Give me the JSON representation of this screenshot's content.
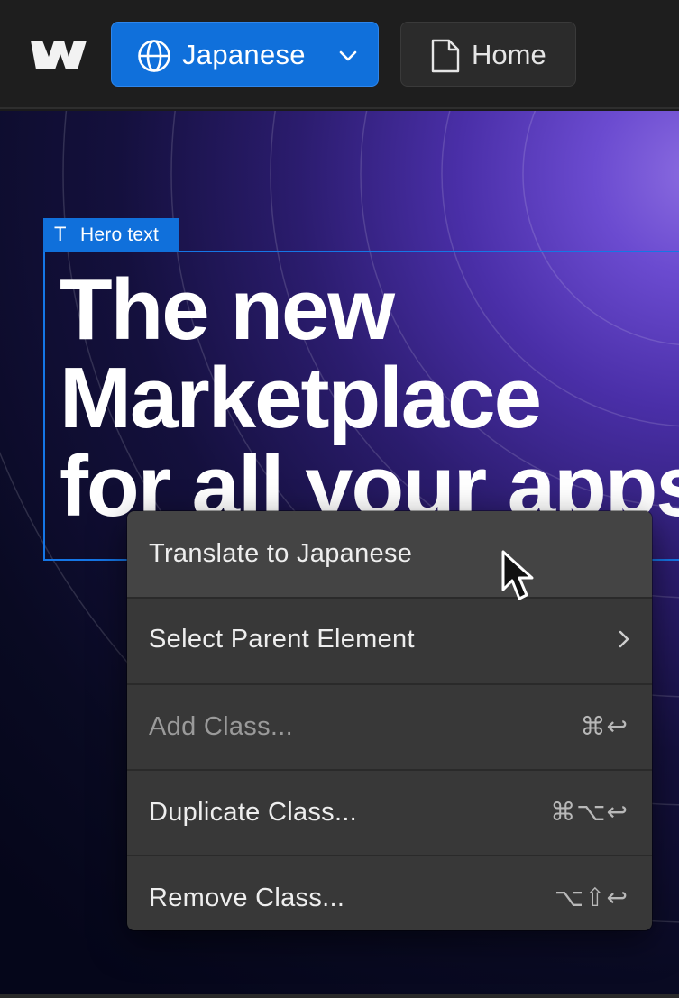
{
  "topbar": {
    "logo_icon": "webflow-logo",
    "locale": {
      "label": "Japanese",
      "icon": "globe-icon",
      "dropdown_icon": "chevron-down-icon"
    },
    "page": {
      "label": "Home",
      "icon": "page-icon"
    }
  },
  "canvas": {
    "selection_tag": {
      "icon": "T",
      "label": "Hero text"
    },
    "hero_lines": [
      "The new",
      "Marketplace",
      "for all your apps"
    ]
  },
  "context_menu": {
    "items": [
      {
        "label": "Translate to Japanese",
        "shortcut": "",
        "submenu": false,
        "disabled": false,
        "highlighted": true
      },
      {
        "label": "Select Parent Element",
        "shortcut": "",
        "submenu": true,
        "disabled": false
      },
      {
        "label": "Add Class...",
        "shortcut": "⌘↩",
        "submenu": false,
        "disabled": true
      },
      {
        "label": "Duplicate Class...",
        "shortcut": "⌘⌥↩",
        "submenu": false,
        "disabled": false
      },
      {
        "label": "Remove Class...",
        "shortcut": "⌥⇧↩",
        "submenu": false,
        "disabled": false
      }
    ]
  },
  "colors": {
    "accent": "#1070db",
    "menu_bg": "#383838",
    "topbar_bg": "#1e1e1e"
  }
}
